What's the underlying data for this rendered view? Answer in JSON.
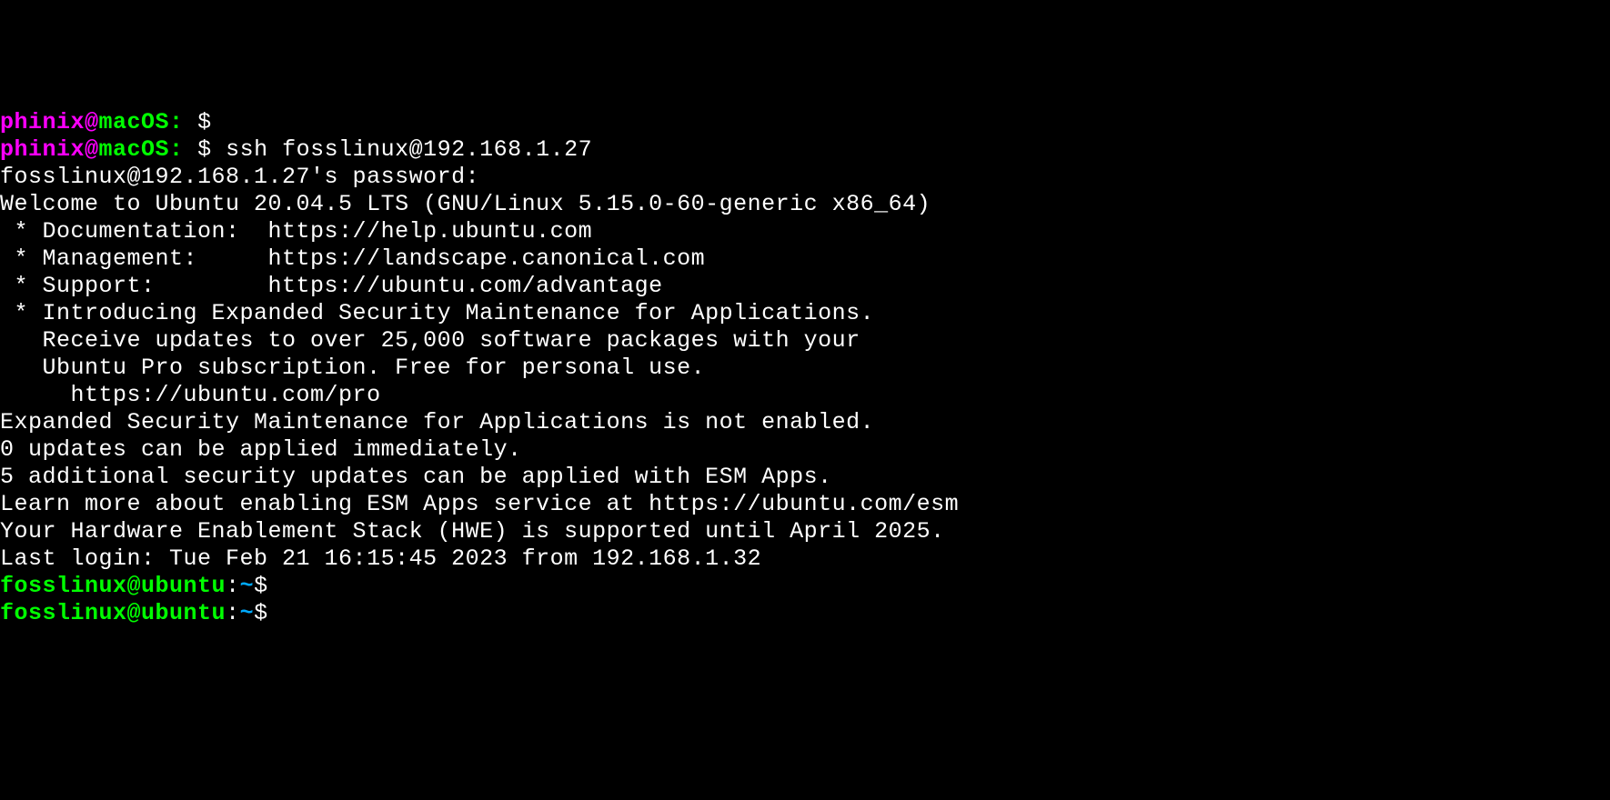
{
  "prompt1": {
    "user": "phinix",
    "at": "@",
    "host": "macOS",
    "colon": ":",
    "space": " ",
    "dollar": "$",
    "command": ""
  },
  "prompt2": {
    "user": "phinix",
    "at": "@",
    "host": "macOS",
    "colon": ":",
    "space": " ",
    "dollar": "$",
    "command": " ssh fosslinux@192.168.1.27"
  },
  "output": {
    "password_prompt": "fosslinux@192.168.1.27's password:",
    "welcome": "Welcome to Ubuntu 20.04.5 LTS (GNU/Linux 5.15.0-60-generic x86_64)",
    "blank1": "",
    "doc_line": " * Documentation:  https://help.ubuntu.com",
    "mgmt_line": " * Management:     https://landscape.canonical.com",
    "support_line": " * Support:        https://ubuntu.com/advantage",
    "blank2": "",
    "esm1": " * Introducing Expanded Security Maintenance for Applications.",
    "esm2": "   Receive updates to over 25,000 software packages with your",
    "esm3": "   Ubuntu Pro subscription. Free for personal use.",
    "blank3": "",
    "esm_url": "     https://ubuntu.com/pro",
    "blank4": "",
    "esm_status": "Expanded Security Maintenance for Applications is not enabled.",
    "blank5": "",
    "updates": "0 updates can be applied immediately.",
    "blank6": "",
    "esm_apps1": "5 additional security updates can be applied with ESM Apps.",
    "esm_apps2": "Learn more about enabling ESM Apps service at https://ubuntu.com/esm",
    "blank7": "",
    "hwe": "Your Hardware Enablement Stack (HWE) is supported until April 2025.",
    "last_login": "Last login: Tue Feb 21 16:15:45 2023 from 192.168.1.32"
  },
  "ubuntu_prompt1": {
    "user": "fosslinux",
    "at": "@",
    "host": "ubuntu",
    "colon": ":",
    "path": "~",
    "dollar": "$"
  },
  "ubuntu_prompt2": {
    "user": "fosslinux",
    "at": "@",
    "host": "ubuntu",
    "colon": ":",
    "path": "~",
    "dollar": "$"
  }
}
